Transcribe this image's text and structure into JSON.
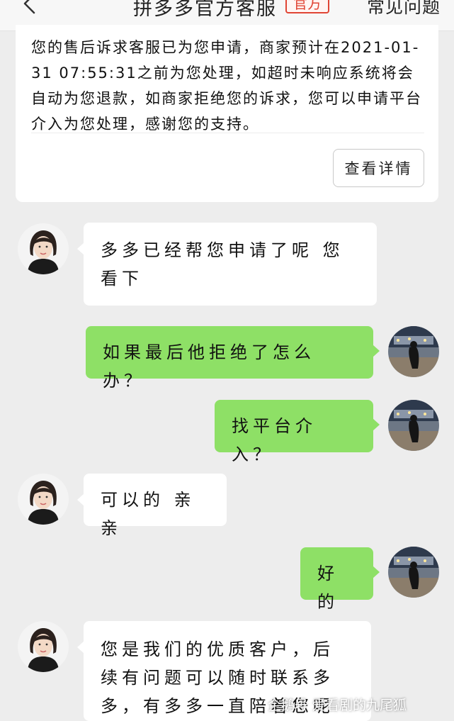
{
  "header": {
    "title": "拼多多官方客服",
    "badge": "官方",
    "faq": "常见问题"
  },
  "notice": {
    "text": "您的售后诉求客服已为您申请，商家预计在2021-01-31 07:55:31之前为您处理，如超时未响应系统将会自动为您退款，如商家拒绝您的诉求，您可以申请平台介入为您处理，感谢您的支持。",
    "detail_button": "查看详情"
  },
  "messages": [
    {
      "sender": "agent",
      "text": "多多已经帮您申请了呢 您看下"
    },
    {
      "sender": "user",
      "text": "如果最后他拒绝了怎么办？"
    },
    {
      "sender": "user",
      "text": "找平台介入？"
    },
    {
      "sender": "agent",
      "text": "可以的 亲亲"
    },
    {
      "sender": "user",
      "text": "好的"
    },
    {
      "sender": "agent",
      "text": "您是我们的优质客户，后续有问题可以随时联系多多，有多多一直陪着您呢"
    }
  ],
  "watermark": "企鹅号 爱看剧的九尾狐"
}
